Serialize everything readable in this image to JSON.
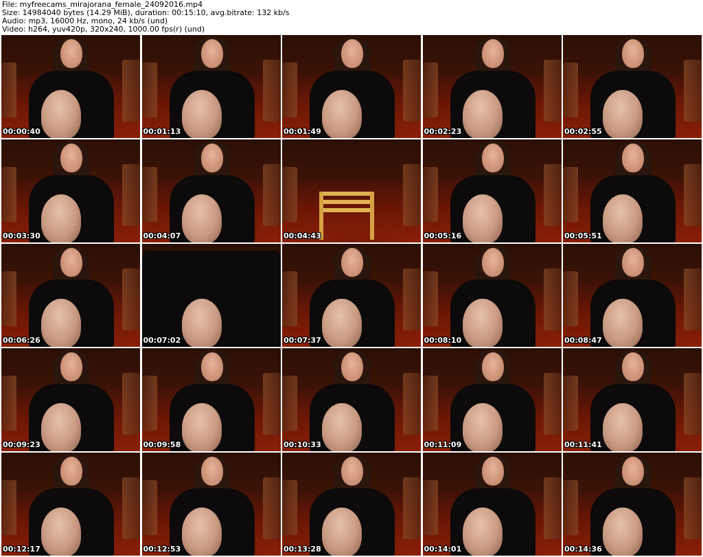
{
  "info": {
    "file": "File: myfreecams_mirajorana_female_24092016.mp4",
    "size": "Size: 14984040 bytes (14.29 MiB), duration: 00:15:10, avg.bitrate: 132 kb/s",
    "audio": "Audio: mp3, 16000 Hz, mono, 24 kb/s (und)",
    "video": "Video: h264, yuv420p, 320x240, 1000.00 fps(r) (und)"
  },
  "thumbnails": [
    {
      "time": "00:00:40",
      "variant": "seated"
    },
    {
      "time": "00:01:13",
      "variant": "seated"
    },
    {
      "time": "00:01:49",
      "variant": "seated"
    },
    {
      "time": "00:02:23",
      "variant": "seated"
    },
    {
      "time": "00:02:55",
      "variant": "seated"
    },
    {
      "time": "00:03:30",
      "variant": "seated"
    },
    {
      "time": "00:04:07",
      "variant": "seated"
    },
    {
      "time": "00:04:43",
      "variant": "empty"
    },
    {
      "time": "00:05:16",
      "variant": "seated"
    },
    {
      "time": "00:05:51",
      "variant": "seated"
    },
    {
      "time": "00:06:26",
      "variant": "seated"
    },
    {
      "time": "00:07:02",
      "variant": "arms-up"
    },
    {
      "time": "00:07:37",
      "variant": "seated"
    },
    {
      "time": "00:08:10",
      "variant": "seated"
    },
    {
      "time": "00:08:47",
      "variant": "seated"
    },
    {
      "time": "00:09:23",
      "variant": "seated"
    },
    {
      "time": "00:09:58",
      "variant": "seated"
    },
    {
      "time": "00:10:33",
      "variant": "seated"
    },
    {
      "time": "00:11:09",
      "variant": "seated"
    },
    {
      "time": "00:11:41",
      "variant": "seated"
    },
    {
      "time": "00:12:17",
      "variant": "seated"
    },
    {
      "time": "00:12:53",
      "variant": "seated"
    },
    {
      "time": "00:13:28",
      "variant": "seated"
    },
    {
      "time": "00:14:01",
      "variant": "seated"
    },
    {
      "time": "00:14:36",
      "variant": "seated"
    }
  ]
}
